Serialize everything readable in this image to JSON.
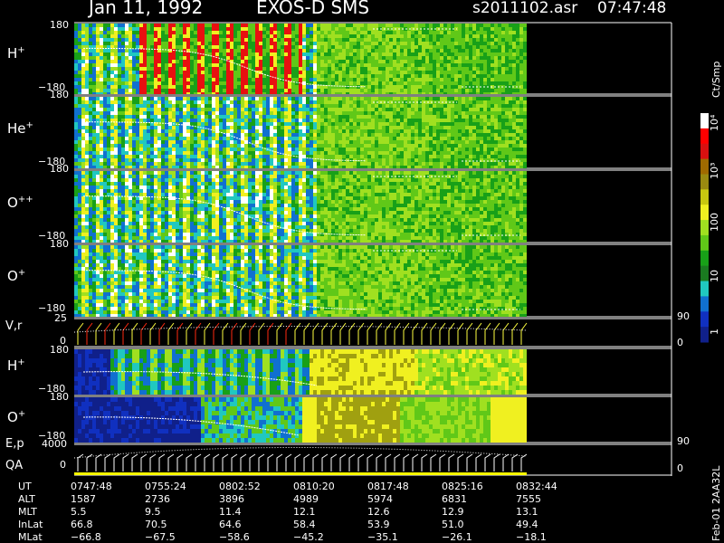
{
  "header": {
    "date": "Jan 11, 1992",
    "mission": "EXOS-D SMS",
    "file": "s2011102.asr",
    "time": "07:47:48"
  },
  "colors": {
    "background": "#000000",
    "text": "#ffffff",
    "trace": "#ffffff",
    "velocity_trace_red": "#ff2a10",
    "velocity_trace_yellow": "#ffff40"
  },
  "chart_data": {
    "type": "heatmap",
    "x_axis": {
      "label": "UT",
      "ticks": [
        "0747:48",
        "0755:24",
        "0802:52",
        "0810:20",
        "0817:48",
        "0825:16",
        "0832:44"
      ]
    },
    "panels": [
      {
        "id": "h_plus",
        "label_base": "H",
        "label_sup": "+",
        "ylim": [
          -180,
          180
        ],
        "ytick_top": "180",
        "ytick_bottom": "−180"
      },
      {
        "id": "he_plus",
        "label_base": "He",
        "label_sup": "+",
        "ylim": [
          -180,
          180
        ],
        "ytick_top": "180",
        "ytick_bottom": "−180"
      },
      {
        "id": "o_plusplus",
        "label_base": "O",
        "label_sup": "++",
        "ylim": [
          -180,
          180
        ],
        "ytick_top": "180",
        "ytick_bottom": "−180"
      },
      {
        "id": "o_plus",
        "label_base": "O",
        "label_sup": "+",
        "ylim": [
          -180,
          180
        ],
        "ytick_top": "180",
        "ytick_bottom": "−180"
      },
      {
        "id": "v_r",
        "label_base": "V,r",
        "label_sup": "",
        "ylim": [
          0,
          25
        ],
        "ytick_top": "25",
        "ytick_bottom": "0",
        "right_top": "90",
        "right_bottom": "0"
      },
      {
        "id": "h_plus_2",
        "label_base": "H",
        "label_sup": "+",
        "ylim": [
          -180,
          180
        ],
        "ytick_top": "180",
        "ytick_bottom": "−180"
      },
      {
        "id": "o_plus_2",
        "label_base": "O",
        "label_sup": "+",
        "ylim": [
          -180,
          180
        ],
        "ytick_top": "180",
        "ytick_bottom": "−180"
      },
      {
        "id": "e_p",
        "label_base": "E,p",
        "label_sup": "",
        "label2": "QA",
        "ylim": [
          0,
          4000
        ],
        "ytick_top": "4000",
        "ytick_bottom": "0",
        "right_top": "90",
        "right_bottom": "0"
      }
    ],
    "colorbar": {
      "unit": "Ct/Smp",
      "ticks": [
        "10⁴",
        "10³",
        "100",
        "10",
        "1"
      ],
      "colors": [
        "#ffffff",
        "#ff0000",
        "#d81010",
        "#a06a00",
        "#9a8a10",
        "#c8c810",
        "#f0f020",
        "#a0e020",
        "#60c818",
        "#18a018",
        "#1a7a20",
        "#20c8c0",
        "#1070d0",
        "#1030c0",
        "#10208a"
      ]
    }
  },
  "ephemeris": {
    "rows": [
      {
        "label": "UT",
        "values": [
          "0747:48",
          "0755:24",
          "0802:52",
          "0810:20",
          "0817:48",
          "0825:16",
          "0832:44"
        ]
      },
      {
        "label": "ALT",
        "values": [
          "1587",
          "2736",
          "3896",
          "4989",
          "5974",
          "6831",
          "7555"
        ]
      },
      {
        "label": "MLT",
        "values": [
          "5.5",
          "9.5",
          "11.4",
          "12.1",
          "12.6",
          "12.9",
          "13.1"
        ]
      },
      {
        "label": "InLat",
        "values": [
          "66.8",
          "70.5",
          "64.6",
          "58.4",
          "53.9",
          "51.0",
          "49.4"
        ]
      },
      {
        "label": "MLat",
        "values": [
          "−66.8",
          "−67.5",
          "−58.6",
          "−45.2",
          "−35.1",
          "−26.1",
          "−18.1"
        ]
      }
    ]
  },
  "footer_stamp": "Feb-01 2AA32L"
}
